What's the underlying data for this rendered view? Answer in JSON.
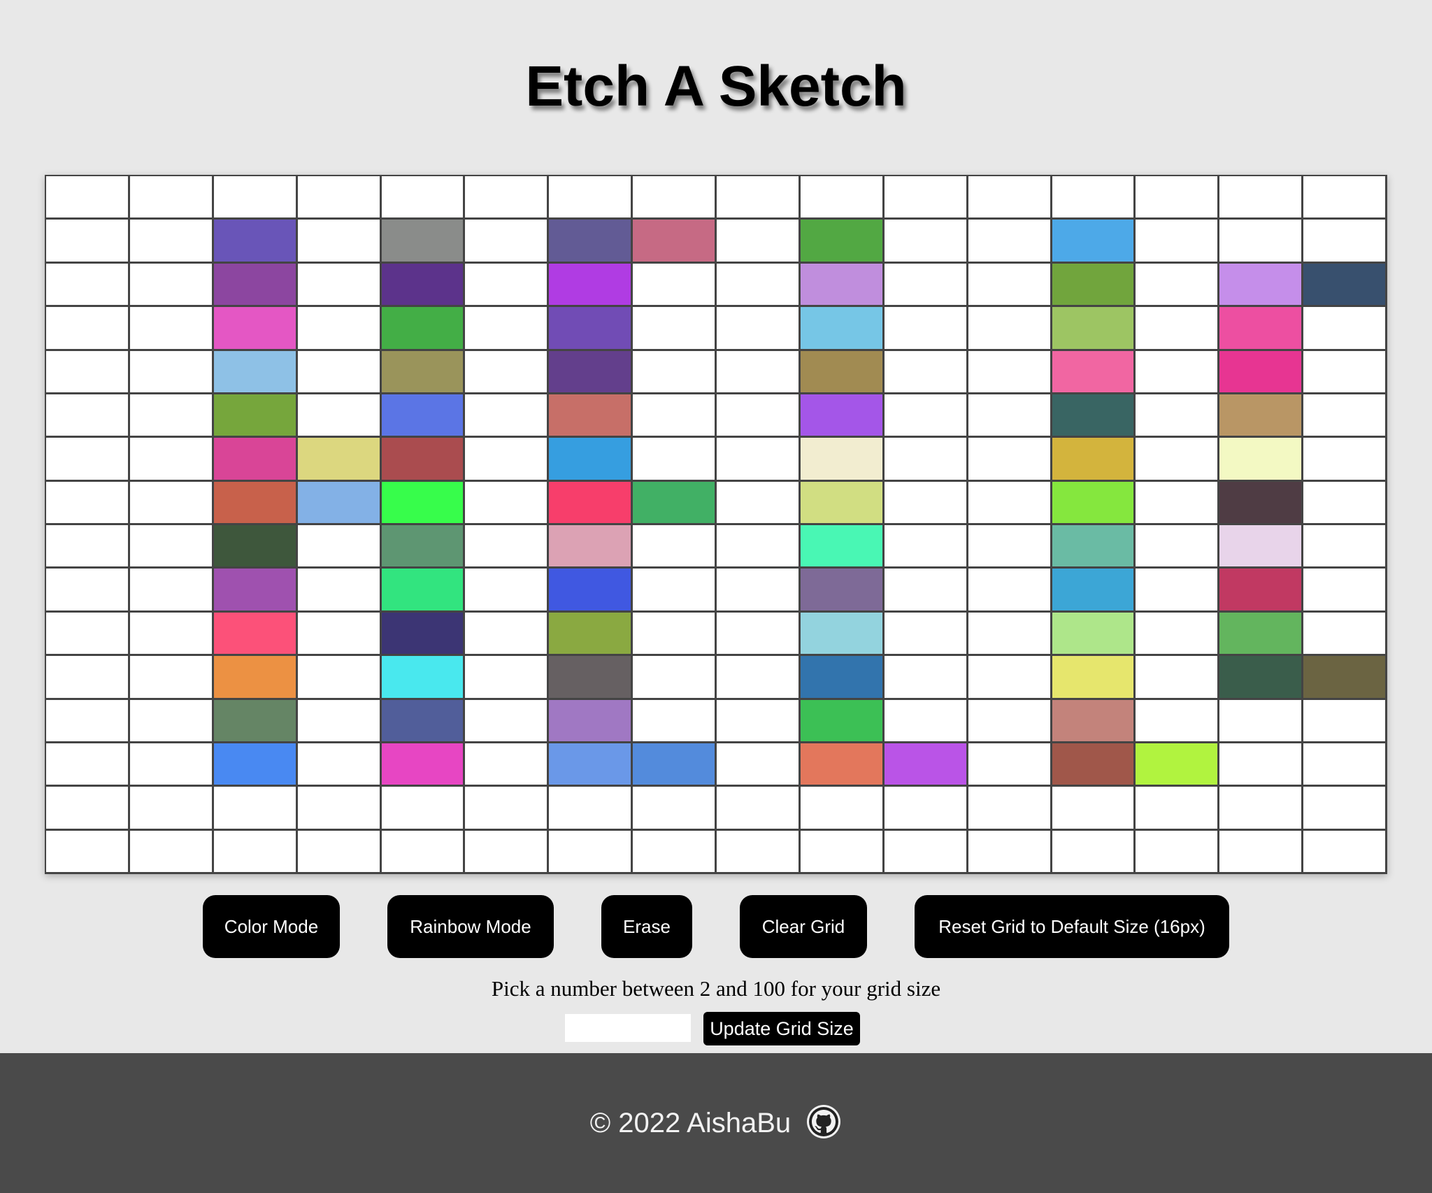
{
  "header": {
    "title": "Etch A Sketch"
  },
  "grid": {
    "size": 16,
    "default_color": "#ffffff",
    "line_color": "#444444",
    "cells": [
      [
        null,
        null,
        null,
        null,
        null,
        null,
        null,
        null,
        null,
        null,
        null,
        null,
        null,
        null,
        null,
        null
      ],
      [
        null,
        null,
        "#6955B8",
        null,
        "#8A8C8A",
        null,
        "#625B95",
        "#C66A84",
        null,
        "#52A843",
        null,
        null,
        "#4DA9E8",
        null,
        null,
        null
      ],
      [
        null,
        null,
        "#8C46A0",
        null,
        "#5C338B",
        null,
        "#B03CE3",
        null,
        null,
        "#C08EDD",
        null,
        null,
        "#71A53D",
        null,
        "#C58EEA",
        "#38506E"
      ],
      [
        null,
        null,
        "#E457C4",
        null,
        "#43AE46",
        null,
        "#714CB5",
        null,
        null,
        "#76C6E6",
        null,
        null,
        "#9DC563",
        null,
        "#ED4FA1",
        null
      ],
      [
        null,
        null,
        "#8EC1E6",
        null,
        "#9A945B",
        null,
        "#633F8C",
        null,
        null,
        "#A18B52",
        null,
        null,
        "#F166A2",
        null,
        "#E73592",
        null
      ],
      [
        null,
        null,
        "#76A63C",
        null,
        "#5B75E5",
        null,
        "#C76F68",
        null,
        null,
        "#A456E8",
        null,
        null,
        "#396563",
        null,
        "#B99665",
        null
      ],
      [
        null,
        null,
        "#D94597",
        "#DCD77F",
        "#AA4C4F",
        null,
        "#369EE0",
        null,
        null,
        "#F2EDD0",
        null,
        null,
        "#D3B43D",
        null,
        "#F3F9C3",
        null
      ],
      [
        null,
        null,
        "#C8614B",
        "#83B1E6",
        "#37FD4B",
        null,
        "#F73E6B",
        "#41B065",
        null,
        "#D1DE82",
        null,
        null,
        "#85E73E",
        null,
        "#4F3C44",
        null
      ],
      [
        null,
        null,
        "#3E573C",
        null,
        "#5E9672",
        null,
        "#DCA2B4",
        null,
        null,
        "#49F7B4",
        null,
        null,
        "#6ABBA4",
        null,
        "#E8D4EA",
        null
      ],
      [
        null,
        null,
        "#9F51AF",
        null,
        "#32E47F",
        null,
        "#4058E1",
        null,
        null,
        "#7E6A97",
        null,
        null,
        "#3CA6D6",
        null,
        "#C13962",
        null
      ],
      [
        null,
        null,
        "#FC5179",
        null,
        "#3C3574",
        null,
        "#8AA941",
        null,
        null,
        "#93D3DE",
        null,
        null,
        "#AEE68A",
        null,
        "#63B55E",
        null
      ],
      [
        null,
        null,
        "#EC9143",
        null,
        "#49E8EE",
        null,
        "#666062",
        null,
        null,
        "#3274AD",
        null,
        null,
        "#E6E66D",
        null,
        "#3A5D4B",
        "#6B6442"
      ],
      [
        null,
        null,
        "#658565",
        null,
        "#515E9A",
        null,
        "#A078C3",
        null,
        null,
        "#3CC055",
        null,
        null,
        "#C3837B",
        null,
        null,
        null
      ],
      [
        null,
        null,
        "#4989F2",
        null,
        "#E746C3",
        null,
        "#6A98E8",
        "#538BDC",
        null,
        "#E3775C",
        "#BA54E7",
        null,
        "#A0574A",
        "#B1F33F",
        null,
        null
      ],
      [
        null,
        null,
        null,
        null,
        null,
        null,
        null,
        null,
        null,
        null,
        null,
        null,
        null,
        null,
        null,
        null
      ],
      [
        null,
        null,
        null,
        null,
        null,
        null,
        null,
        null,
        null,
        null,
        null,
        null,
        null,
        null,
        null,
        null
      ]
    ]
  },
  "controls": {
    "color_mode_label": "Color Mode",
    "rainbow_mode_label": "Rainbow Mode",
    "erase_label": "Erase",
    "clear_grid_label": "Clear Grid",
    "reset_label": "Reset Grid to Default Size (16px)"
  },
  "size_picker": {
    "prompt": "Pick a number between 2 and 100 for your grid size",
    "input_value": "",
    "update_label": "Update Grid Size"
  },
  "footer": {
    "copyright": "© 2022 AishaBu",
    "icon": "github-icon"
  },
  "colors": {
    "page_background": "#e8e8e8",
    "button_background": "#000000",
    "button_text": "#ffffff",
    "footer_background": "#4a4a4a",
    "footer_text": "#f2f2f2"
  }
}
